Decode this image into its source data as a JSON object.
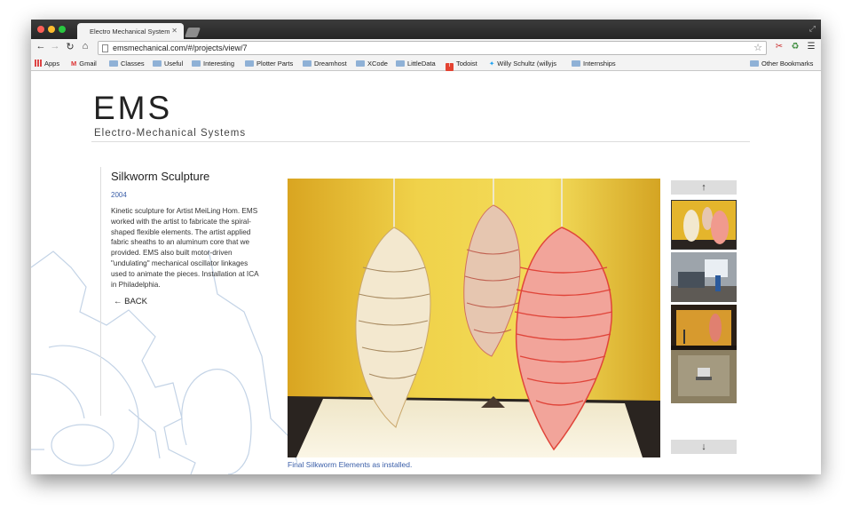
{
  "browser": {
    "tab_title": "Electro Mechanical System",
    "url": "emsmechanical.com/#/projects/view/7",
    "bookmarks": [
      {
        "label": "Apps",
        "icon": "apps-icon"
      },
      {
        "label": "Gmail",
        "icon": "gmail-icon"
      },
      {
        "label": "Classes",
        "icon": "folder-icon"
      },
      {
        "label": "Useful",
        "icon": "folder-icon"
      },
      {
        "label": "Interesting",
        "icon": "folder-icon"
      },
      {
        "label": "Plotter Parts",
        "icon": "folder-icon"
      },
      {
        "label": "Dreamhost",
        "icon": "folder-icon"
      },
      {
        "label": "XCode",
        "icon": "folder-icon"
      },
      {
        "label": "LittleData",
        "icon": "folder-icon"
      },
      {
        "label": "Todoist",
        "icon": "todoist-icon"
      },
      {
        "label": "Willy Schultz (willyjs",
        "icon": "twitter-icon"
      },
      {
        "label": "Internships",
        "icon": "folder-icon"
      }
    ],
    "other_bookmarks": "Other Bookmarks"
  },
  "site": {
    "logo": "EMS",
    "tagline": "Electro-Mechanical Systems"
  },
  "project": {
    "title": "Silkworm Sculpture",
    "year": "2004",
    "description": "Kinetic sculpture for Artist MeiLing Hom. EMS worked with the artist to fabricate the spiral-shaped flexible elements. The artist applied fabric sheaths to an aluminum core that we provided. EMS also built motor-driven \"undulating\" mechanical oscillator linkages used to animate the pieces. Installation at ICA in Philadelphia.",
    "back_label": "← BACK",
    "caption": "Final Silkworm Elements as installed.",
    "scroll_up": "↑",
    "scroll_down": "↓"
  },
  "colors": {
    "link": "#3a5ea8",
    "photo_wall": "#e6c238"
  }
}
